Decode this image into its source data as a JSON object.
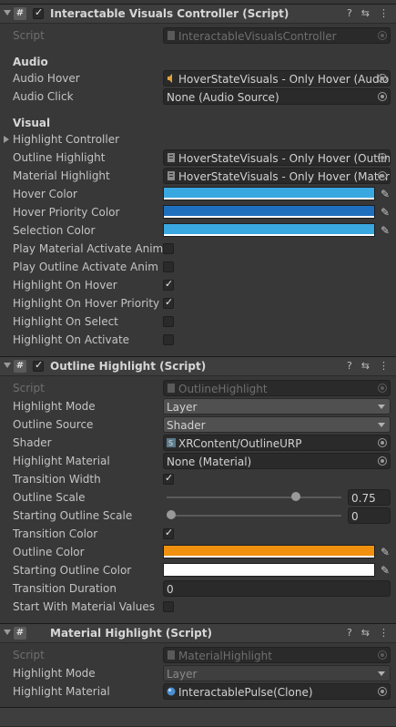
{
  "components": [
    {
      "title": "Interactable Visuals Controller (Script)",
      "script_label": "Script",
      "script_value": "InteractableVisualsController",
      "sections": {
        "audio": "Audio",
        "visual": "Visual"
      },
      "audio_hover": {
        "label": "Audio Hover",
        "value": "HoverStateVisuals - Only Hover (Audio"
      },
      "audio_click": {
        "label": "Audio Click",
        "value": "None (Audio Source)"
      },
      "highlight_controller": "Highlight Controller",
      "outline_highlight": {
        "label": "Outline Highlight",
        "value": "HoverStateVisuals - Only Hover (Outlin"
      },
      "material_highlight": {
        "label": "Material Highlight",
        "value": "HoverStateVisuals - Only Hover (Mater"
      },
      "hover_color": {
        "label": "Hover Color",
        "color": "#3aa8e0"
      },
      "hover_priority_color": {
        "label": "Hover Priority Color",
        "color": "#1f6fbf"
      },
      "selection_color": {
        "label": "Selection Color",
        "color": "#3aa8e0"
      },
      "toggles": [
        {
          "label": "Play Material Activate Anim",
          "checked": false
        },
        {
          "label": "Play Outline Activate Anim",
          "checked": false
        },
        {
          "label": "Highlight On Hover",
          "checked": true
        },
        {
          "label": "Highlight On Hover Priority",
          "checked": true
        },
        {
          "label": "Highlight On Select",
          "checked": false
        },
        {
          "label": "Highlight On Activate",
          "checked": false
        }
      ]
    },
    {
      "title": "Outline Highlight (Script)",
      "script_label": "Script",
      "script_value": "OutlineHighlight",
      "highlight_mode": {
        "label": "Highlight Mode",
        "value": "Layer"
      },
      "outline_source": {
        "label": "Outline Source",
        "value": "Shader"
      },
      "shader": {
        "label": "Shader",
        "value": "XRContent/OutlineURP"
      },
      "highlight_material": {
        "label": "Highlight Material",
        "value": "None (Material)"
      },
      "transition_width": {
        "label": "Transition Width",
        "checked": true
      },
      "outline_scale": {
        "label": "Outline Scale",
        "value": "0.75",
        "fraction": 0.75
      },
      "starting_outline_scale": {
        "label": "Starting Outline Scale",
        "value": "0",
        "fraction": 0
      },
      "transition_color": {
        "label": "Transition Color",
        "checked": true
      },
      "outline_color": {
        "label": "Outline Color",
        "color": "#f0900f"
      },
      "starting_outline_color": {
        "label": "Starting Outline Color",
        "color": "#ffffff"
      },
      "transition_duration": {
        "label": "Transition Duration",
        "value": "0"
      },
      "start_with_material_values": {
        "label": "Start With Material Values",
        "checked": false
      }
    },
    {
      "title": "Material Highlight (Script)",
      "script_label": "Script",
      "script_value": "MaterialHighlight",
      "highlight_mode": {
        "label": "Highlight Mode",
        "value": "Layer"
      },
      "highlight_material": {
        "label": "Highlight Material",
        "value": "InteractablePulse(Clone)"
      }
    }
  ],
  "icons": {
    "help": "help-icon",
    "presets": "presets-icon",
    "menu": "kebab-menu-icon"
  }
}
